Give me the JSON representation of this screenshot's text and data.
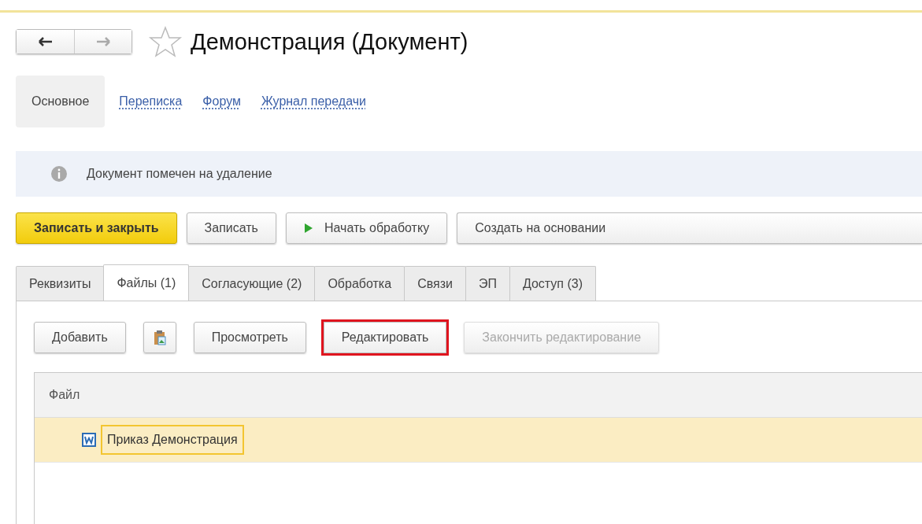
{
  "window": {
    "title": "Демонстрация (Документ)",
    "favorite": false
  },
  "sections": [
    {
      "label": "Основное",
      "selected": true
    },
    {
      "label": "Переписка",
      "selected": false
    },
    {
      "label": "Форум",
      "selected": false
    },
    {
      "label": "Журнал передачи",
      "selected": false
    }
  ],
  "info_bar": {
    "text": "Документ помечен на удаление"
  },
  "command_bar": [
    {
      "label": "Записать и закрыть",
      "kind": "default"
    },
    {
      "label": "Записать",
      "kind": "plain"
    },
    {
      "label": "Начать обработку",
      "kind": "play"
    },
    {
      "label": "Создать на основании",
      "kind": "dropdown"
    }
  ],
  "tabs": [
    {
      "label": "Реквизиты",
      "selected": false
    },
    {
      "label": "Файлы (1)",
      "selected": true
    },
    {
      "label": "Согласующие (2)",
      "selected": false
    },
    {
      "label": "Обработка",
      "selected": false
    },
    {
      "label": "Связи",
      "selected": false
    },
    {
      "label": "ЭП",
      "selected": false
    },
    {
      "label": "Доступ (3)",
      "selected": false
    }
  ],
  "files_toolbar": [
    {
      "label": "Добавить",
      "kind": "text",
      "disabled": false,
      "highlighted": false
    },
    {
      "kind": "icon",
      "disabled": false,
      "highlighted": false
    },
    {
      "label": "Просмотреть",
      "kind": "text",
      "disabled": false,
      "highlighted": false
    },
    {
      "label": "Редактировать",
      "kind": "text",
      "disabled": false,
      "highlighted": true
    },
    {
      "label": "Закончить редактирование",
      "kind": "text",
      "disabled": true,
      "highlighted": false
    }
  ],
  "table": {
    "columns": [
      "Файл"
    ],
    "rows": [
      {
        "name": "Приказ Демонстрация",
        "selected": true
      }
    ]
  }
}
